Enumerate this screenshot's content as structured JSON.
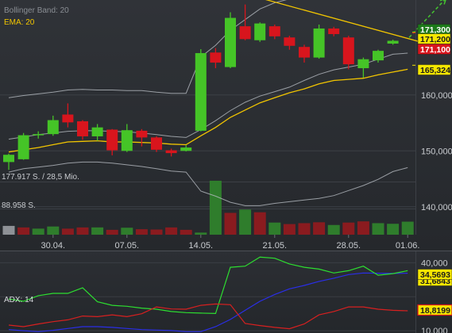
{
  "colors": {
    "up": "#45c427",
    "down": "#d8151d",
    "bollinger": "#b7bcc2",
    "ema": "#f2c500",
    "trendline": "#f2c500",
    "arrow": "#44c530",
    "volume_up": "#2f7d2c",
    "volume_down": "#8a1b1f",
    "volume_neutral": "#8e9196",
    "adx": "#2a2ee8",
    "di_plus": "#2dde30",
    "di_minus": "#d82020"
  },
  "chart_data": [
    {
      "type": "candlestick",
      "panel": "price",
      "indicators": [
        "Bollinger Band: 20",
        "EMA: 20"
      ],
      "x_tick_labels": [
        {
          "label": "30.04.",
          "index": 3
        },
        {
          "label": "07.05.",
          "index": 8
        },
        {
          "label": "14.05.",
          "index": 13
        },
        {
          "label": "21.05.",
          "index": 18
        },
        {
          "label": "28.05.",
          "index": 23
        },
        {
          "label": "01.06.",
          "index": 27
        }
      ],
      "y_ticks": [
        "140,000",
        "150,000",
        "160,000"
      ],
      "ylim": [
        135,
        177
      ],
      "candles": [
        {
          "o": 148.0,
          "h": 149.5,
          "l": 146.6,
          "c": 149.3
        },
        {
          "o": 148.5,
          "h": 153.2,
          "l": 148.4,
          "c": 152.8
        },
        {
          "o": 152.8,
          "h": 153.5,
          "l": 152.2,
          "c": 153.0
        },
        {
          "o": 153.0,
          "h": 156.3,
          "l": 152.7,
          "c": 155.5
        },
        {
          "o": 156.5,
          "h": 158.5,
          "l": 154.2,
          "c": 155.1
        },
        {
          "o": 155.3,
          "h": 155.5,
          "l": 152.0,
          "c": 152.6
        },
        {
          "o": 152.6,
          "h": 154.8,
          "l": 151.8,
          "c": 154.2
        },
        {
          "o": 153.8,
          "h": 153.9,
          "l": 149.2,
          "c": 150.1
        },
        {
          "o": 150.0,
          "h": 154.8,
          "l": 149.8,
          "c": 153.7
        },
        {
          "o": 153.6,
          "h": 153.9,
          "l": 150.8,
          "c": 152.4
        },
        {
          "o": 152.4,
          "h": 152.6,
          "l": 149.8,
          "c": 150.2
        },
        {
          "o": 150.1,
          "h": 150.4,
          "l": 149.0,
          "c": 149.6
        },
        {
          "o": 150.0,
          "h": 151.0,
          "l": 149.9,
          "c": 150.6
        },
        {
          "o": 153.6,
          "h": 168.2,
          "l": 153.5,
          "c": 167.5
        },
        {
          "o": 167.6,
          "h": 168.4,
          "l": 164.8,
          "c": 165.8
        },
        {
          "o": 165.0,
          "h": 174.8,
          "l": 164.8,
          "c": 173.8
        },
        {
          "o": 172.3,
          "h": 176.2,
          "l": 169.8,
          "c": 170.0
        },
        {
          "o": 169.8,
          "h": 173.0,
          "l": 169.5,
          "c": 172.8
        },
        {
          "o": 172.3,
          "h": 172.6,
          "l": 170.0,
          "c": 170.5
        },
        {
          "o": 170.3,
          "h": 170.6,
          "l": 168.1,
          "c": 168.8
        },
        {
          "o": 168.6,
          "h": 169.0,
          "l": 165.8,
          "c": 166.7
        },
        {
          "o": 166.7,
          "h": 172.6,
          "l": 166.5,
          "c": 171.9
        },
        {
          "o": 171.9,
          "h": 172.2,
          "l": 170.5,
          "c": 170.9
        },
        {
          "o": 170.3,
          "h": 170.6,
          "l": 164.6,
          "c": 165.5
        },
        {
          "o": 164.8,
          "h": 166.7,
          "l": 163.1,
          "c": 166.4
        },
        {
          "o": 166.2,
          "h": 168.1,
          "l": 165.8,
          "c": 167.9
        },
        {
          "o": 169.2,
          "h": 169.9,
          "l": 169.0,
          "c": 169.7
        }
      ],
      "bollinger_upper": [
        159.5,
        159.9,
        160.2,
        160.5,
        160.9,
        161.0,
        160.9,
        160.9,
        160.8,
        160.8,
        160.5,
        160.3,
        160.3,
        166.8,
        168.9,
        171.6,
        173.5,
        175.4,
        176.5,
        177.2,
        177.6,
        178.3,
        178.5,
        178.3,
        178.1,
        177.9,
        177.8,
        177.8
      ],
      "bollinger_middle": [
        152.1,
        152.5,
        152.9,
        153.2,
        153.5,
        153.6,
        153.6,
        153.5,
        153.4,
        153.2,
        152.9,
        152.6,
        152.4,
        153.8,
        155.4,
        157.2,
        158.7,
        159.8,
        160.6,
        161.4,
        162.6,
        163.7,
        164.5,
        165.0,
        165.5,
        166.4,
        167.3,
        167.5
      ],
      "bollinger_lower": [
        146.2,
        146.8,
        147.1,
        147.4,
        147.8,
        148.0,
        148.0,
        147.8,
        147.5,
        147.2,
        146.8,
        146.4,
        146.2,
        142.8,
        141.9,
        140.8,
        140.2,
        140.2,
        140.6,
        140.9,
        141.2,
        141.5,
        142.0,
        142.9,
        143.8,
        144.9,
        146.3,
        147.0
      ],
      "ema": [
        149.8,
        150.2,
        150.6,
        151.1,
        151.6,
        151.7,
        151.8,
        151.6,
        151.6,
        151.5,
        151.4,
        151.2,
        151.1,
        152.7,
        154.2,
        156.0,
        157.3,
        158.6,
        159.5,
        160.4,
        161.1,
        162.0,
        162.6,
        162.8,
        163.0,
        163.6,
        164.1,
        164.6
      ],
      "trendline": {
        "x": [
          15.7,
          28.0
        ],
        "y": [
          178.3,
          169.4
        ]
      },
      "projection_arrow": {
        "x": [
          27.1,
          29.6
        ],
        "y": [
          170.3,
          177.3
        ]
      },
      "price_labels": [
        "171,300",
        "171,200",
        "171,100",
        "165,324"
      ],
      "volume": {
        "label_upper": "177.917 S. / 28,5 Mio.",
        "label_lower": "88.958 S.",
        "max": 177917,
        "values": [
          29000,
          24000,
          20000,
          27000,
          20000,
          24000,
          24000,
          16000,
          23000,
          18000,
          17000,
          24000,
          16000,
          7000,
          178000,
          72000,
          83000,
          74000,
          40000,
          35000,
          38000,
          41000,
          32000,
          40000,
          44000,
          38000,
          36000,
          43000
        ],
        "direction": [
          "neutral",
          "down",
          "up",
          "up",
          "down",
          "down",
          "up",
          "down",
          "up",
          "down",
          "down",
          "down",
          "down",
          "up",
          "up",
          "down",
          "up",
          "down",
          "up",
          "down",
          "down",
          "down",
          "up",
          "down",
          "down",
          "up",
          "up",
          "up"
        ]
      }
    },
    {
      "type": "line",
      "panel": "indicator",
      "title": "ADX: 14",
      "y_ticks": [
        "10,000",
        "40,000"
      ],
      "ylim": [
        9,
        44
      ],
      "series": [
        {
          "key": "adx",
          "values": [
            10.5,
            10.0,
            9.6,
            10.2,
            11.0,
            11.8,
            11.8,
            11.5,
            11.0,
            10.5,
            10.3,
            10.1,
            9.6,
            9.6,
            11.8,
            15.0,
            19.0,
            23.0,
            26.0,
            28.5,
            30.0,
            31.8,
            33.2,
            34.8,
            35.5,
            35.4,
            35.3,
            35.4
          ]
        },
        {
          "key": "di_plus",
          "values": [
            24.0,
            23.0,
            25.5,
            26.5,
            26.5,
            29.0,
            22.8,
            21.2,
            20.8,
            20.0,
            19.5,
            18.5,
            18.0,
            17.8,
            17.6,
            38.0,
            38.5,
            42.5,
            42.0,
            39.5,
            38.0,
            37.2,
            35.5,
            36.5,
            38.5,
            34.5,
            35.2,
            36.5
          ]
        },
        {
          "key": "di_minus",
          "values": [
            12.5,
            11.8,
            13.0,
            14.0,
            14.8,
            16.5,
            16.2,
            17.0,
            16.2,
            17.5,
            20.5,
            19.6,
            19.5,
            21.2,
            21.8,
            21.5,
            13.2,
            12.3,
            11.5,
            10.9,
            13.0,
            17.0,
            18.5,
            20.5,
            20.5,
            19.5,
            19.0,
            18.8
          ]
        }
      ],
      "value_labels": [
        "34,5693",
        "31,6843",
        "18,8199"
      ]
    }
  ]
}
